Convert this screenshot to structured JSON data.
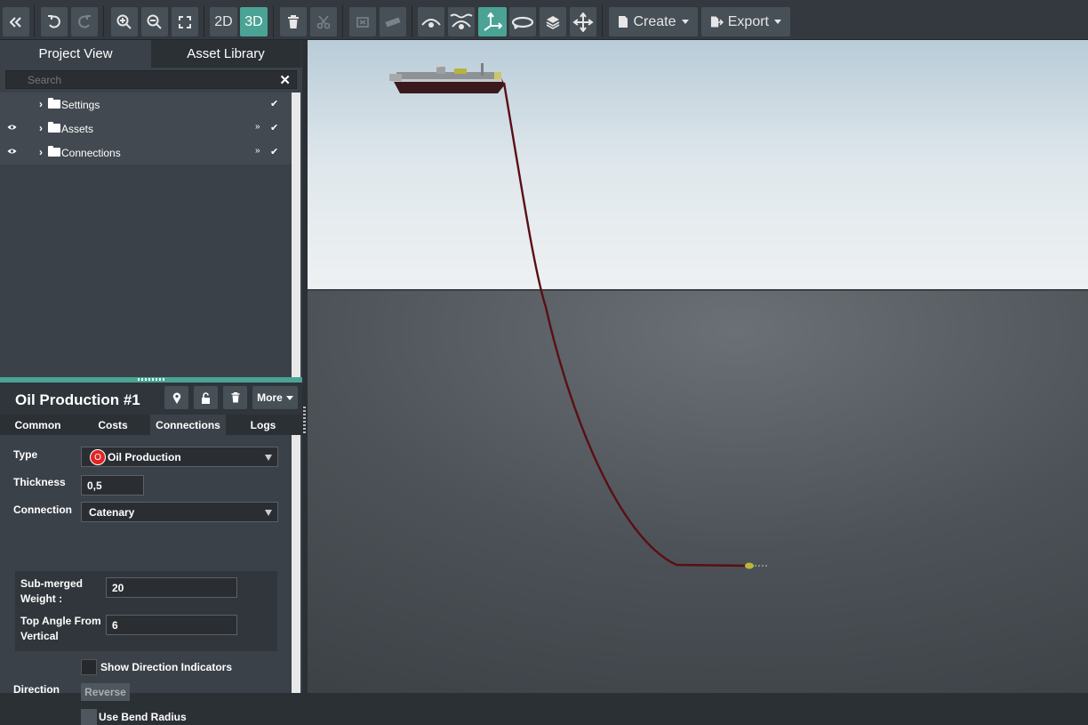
{
  "toolbar": {
    "view_2d": "2D",
    "view_3d": "3D",
    "create_label": "Create",
    "export_label": "Export"
  },
  "panel": {
    "tabs": [
      "Project View",
      "Asset Library"
    ],
    "search_placeholder": "Search",
    "tree": [
      {
        "label": "Settings",
        "visible_toggle": false
      },
      {
        "label": "Assets",
        "visible_toggle": true
      },
      {
        "label": "Connections",
        "visible_toggle": true
      }
    ]
  },
  "properties": {
    "title": "Oil Production #1",
    "more_label": "More",
    "tabs": [
      "Common",
      "Costs",
      "Connections",
      "Logs"
    ],
    "active_tab": "Connections",
    "fields": {
      "type_label": "Type",
      "type_value": "Oil Production",
      "type_badge": "O",
      "thickness_label": "Thickness",
      "thickness_value": "0,5",
      "connection_label": "Connection",
      "connection_value": "Catenary",
      "submerged_label_1": "Sub-merged",
      "submerged_label_2": "Weight :",
      "submerged_value": "20",
      "topangle_label_1": "Top Angle From",
      "topangle_label_2": "Vertical",
      "topangle_value": "6",
      "show_direction_label": "Show Direction Indicators",
      "direction_label": "Direction",
      "reverse_label": "Reverse",
      "bend_radius_label": "Use Bend Radius"
    }
  },
  "colors": {
    "accent": "#4aa394",
    "badge_red": "#e02424",
    "riser": "#5a0f14"
  }
}
